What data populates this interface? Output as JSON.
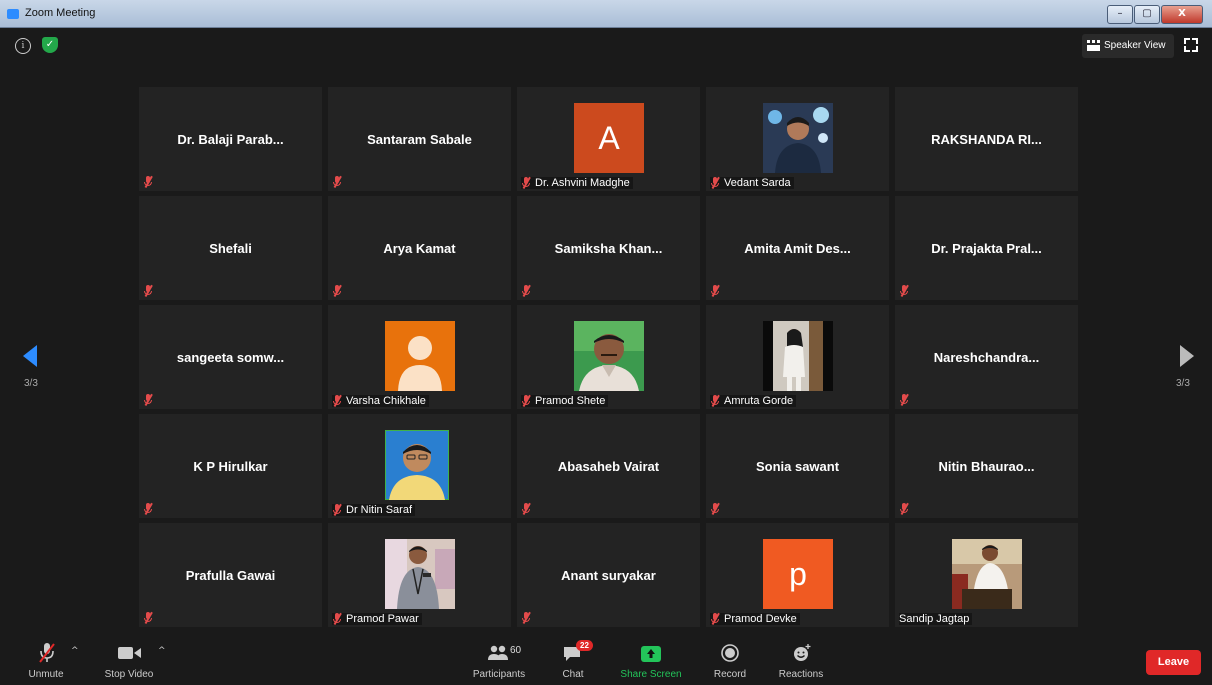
{
  "window": {
    "title": "Zoom Meeting",
    "minimize": "–",
    "maximize": "▢",
    "close": "X"
  },
  "topbar": {
    "speaker_view": "Speaker View"
  },
  "gallery": {
    "page_indicator_left": "3/3",
    "page_indicator_right": "3/3",
    "tiles": [
      {
        "name": "Dr. Balaji Parab...",
        "type": "name",
        "muted": true
      },
      {
        "name": "Santaram Sabale",
        "type": "name",
        "muted": true
      },
      {
        "name": "Dr. Ashvini Madghe",
        "type": "letter",
        "letter": "A",
        "color": "#cc4a1e",
        "muted": true
      },
      {
        "name": "Vedant Sarda",
        "type": "photo",
        "muted": true
      },
      {
        "name": "RAKSHANDA RI...",
        "type": "name",
        "muted": false
      },
      {
        "name": "Shefali",
        "type": "name",
        "muted": true
      },
      {
        "name": "Arya Kamat",
        "type": "name",
        "muted": true
      },
      {
        "name": "Samiksha Khan...",
        "type": "name",
        "muted": true
      },
      {
        "name": "Amita Amit Des...",
        "type": "name",
        "muted": true
      },
      {
        "name": "Dr. Prajakta Pral...",
        "type": "name",
        "muted": true
      },
      {
        "name": "sangeeta somw...",
        "type": "name",
        "muted": true
      },
      {
        "name": "Varsha Chikhale",
        "type": "default-avatar",
        "color": "#e8720c",
        "muted": true
      },
      {
        "name": "Pramod Shete",
        "type": "photo",
        "muted": true
      },
      {
        "name": "Amruta Gorde",
        "type": "photo",
        "muted": true
      },
      {
        "name": "Nareshchandra...",
        "type": "name",
        "muted": true
      },
      {
        "name": "K P Hirulkar",
        "type": "name",
        "muted": true
      },
      {
        "name": "Dr Nitin Saraf",
        "type": "photo",
        "muted": true
      },
      {
        "name": "Abasaheb Vairat",
        "type": "name",
        "muted": true
      },
      {
        "name": "Sonia sawant",
        "type": "name",
        "muted": true
      },
      {
        "name": "Nitin Bhaurao...",
        "type": "name",
        "muted": true
      },
      {
        "name": "Prafulla Gawai",
        "type": "name",
        "muted": true
      },
      {
        "name": "Pramod Pawar",
        "type": "photo",
        "muted": true
      },
      {
        "name": "Anant suryakar",
        "type": "name",
        "muted": true
      },
      {
        "name": "Pramod Devke",
        "type": "letter",
        "letter": "p",
        "color": "#f05a22",
        "muted": true
      },
      {
        "name": "Sandip Jagtap",
        "type": "photo",
        "muted": false
      }
    ]
  },
  "toolbar": {
    "unmute": "Unmute",
    "stop_video": "Stop Video",
    "participants": "Participants",
    "participants_count": "60",
    "chat": "Chat",
    "chat_badge": "22",
    "share_screen": "Share Screen",
    "record": "Record",
    "reactions": "Reactions",
    "leave": "Leave"
  }
}
